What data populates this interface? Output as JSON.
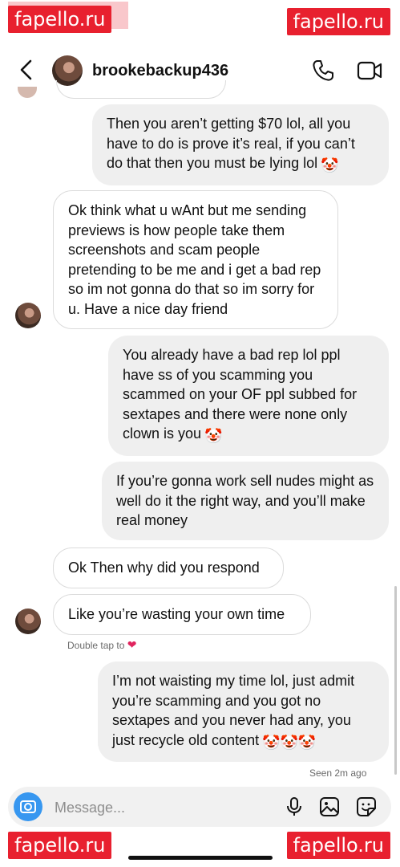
{
  "watermarks": {
    "top_left": "fapello.ru",
    "top_right": "fapello.ru",
    "bottom_left": "fapello.ru",
    "bottom_right": "fapello.ru"
  },
  "header": {
    "username": "brookebackup436",
    "icons": [
      "back-chevron-icon",
      "phone-icon",
      "video-icon"
    ]
  },
  "messages": [
    {
      "side": "outgoing",
      "text": "Then you aren’t getting $70 lol, all you have to do is prove it’s real, if you can’t do that then you must be lying lol",
      "emoji": "🤡"
    },
    {
      "side": "incoming",
      "text": "Ok think what u wAnt but me sending previews is how people take them screenshots and scam people pretending to be me and i get a bad rep so im not gonna do that so im sorry for u. Have a nice day friend"
    },
    {
      "side": "outgoing",
      "text": "You already have a bad rep lol ppl have ss of you scamming you scammed on your OF ppl subbed for sextapes and there were none only clown is you",
      "emoji": "🤡"
    },
    {
      "side": "outgoing",
      "text": "If you’re gonna work sell nudes might as well do it the right way, and you’ll make real money"
    },
    {
      "side": "incoming",
      "text": "Ok Then why did you respond"
    },
    {
      "side": "incoming",
      "text": "Like you’re wasting your own time"
    },
    {
      "side": "outgoing",
      "text": "I’m not waisting my time lol, just admit you’re scamming and you got no sextapes and you never had any, you just recycle old content",
      "emoji": "🤡🤡🤡"
    }
  ],
  "double_tap_hint": "Double tap to",
  "seen_status": "Seen 2m ago",
  "composer": {
    "placeholder": "Message...",
    "icons": [
      "camera-icon",
      "microphone-icon",
      "gallery-icon",
      "sticker-icon"
    ]
  },
  "colors": {
    "accent": "#3797f0",
    "outgoing_bubble": "#efefef",
    "incoming_border": "#dbdbdb",
    "watermark": "#e8202f",
    "heart": "#e0245e"
  }
}
